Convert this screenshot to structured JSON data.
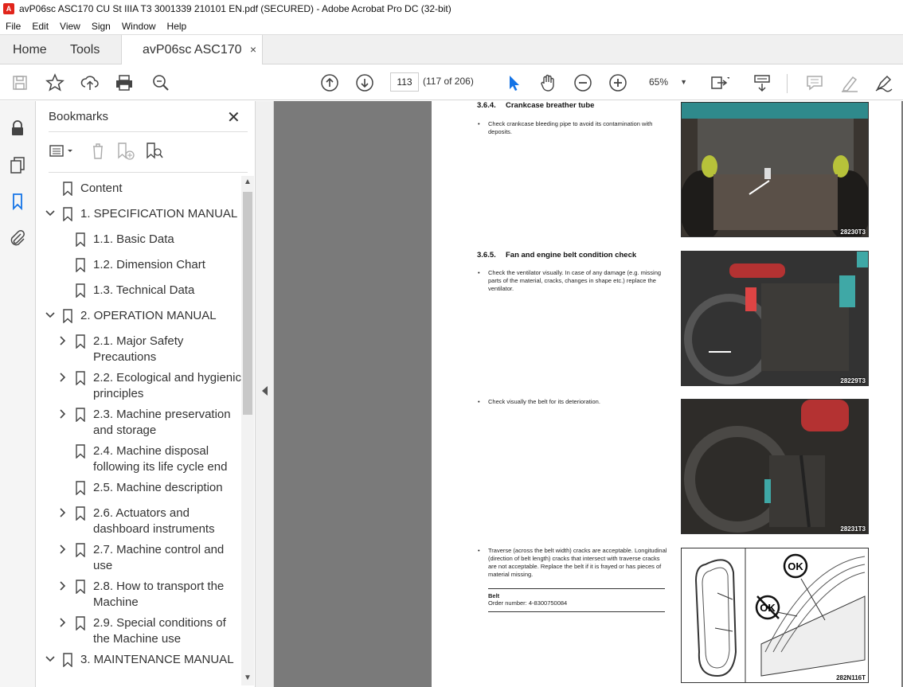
{
  "window": {
    "title": "avP06sc ASC170 CU St IIIA T3 3001339 210101 EN.pdf (SECURED) - Adobe Acrobat Pro DC (32-bit)"
  },
  "menu": [
    "File",
    "Edit",
    "View",
    "Sign",
    "Window",
    "Help"
  ],
  "tabs": {
    "home": "Home",
    "tools": "Tools",
    "document": "avP06sc ASC170 C...",
    "close": "×"
  },
  "toolbar": {
    "page_current": "113",
    "page_count": "(117 of 206)",
    "zoom": "65%",
    "icons": [
      "save-icon",
      "star-icon",
      "upload-icon",
      "print-icon",
      "search-zoom-icon",
      "page-up-icon",
      "page-down-icon",
      "select-arrow-icon",
      "hand-icon",
      "zoom-out-icon",
      "zoom-in-icon",
      "page-fit-icon",
      "scroll-mode-icon",
      "comment-icon",
      "highlight-icon",
      "sign-icon"
    ]
  },
  "leftrail": {
    "icons": [
      "lock-icon",
      "pages-icon",
      "bookmark-icon",
      "attachment-icon"
    ]
  },
  "bookmarks": {
    "title": "Bookmarks",
    "items": [
      {
        "label": "Content",
        "level": 0,
        "expander": "none"
      },
      {
        "label": "1. SPECIFICATION MANUAL",
        "level": 0,
        "expander": "expanded"
      },
      {
        "label": "1.1. Basic Data",
        "level": 1,
        "expander": "none"
      },
      {
        "label": "1.2. Dimension Chart",
        "level": 1,
        "expander": "none"
      },
      {
        "label": "1.3. Technical Data",
        "level": 1,
        "expander": "none"
      },
      {
        "label": "2. OPERATION MANUAL",
        "level": 0,
        "expander": "expanded"
      },
      {
        "label": "2.1. Major Safety",
        "label2": "Precautions",
        "level": 1,
        "expander": "collapsed"
      },
      {
        "label": "2.2. Ecological and hygienic",
        "label2": "principles",
        "level": 1,
        "expander": "collapsed"
      },
      {
        "label": "2.3. Machine preservation",
        "label2": "and storage",
        "level": 1,
        "expander": "collapsed"
      },
      {
        "label": "2.4. Machine disposal",
        "label2": "following its life cycle end",
        "level": 1,
        "expander": "none"
      },
      {
        "label": "2.5. Machine description",
        "level": 1,
        "expander": "none"
      },
      {
        "label": "2.6. Actuators and",
        "label2": "dashboard instruments",
        "level": 1,
        "expander": "collapsed"
      },
      {
        "label": "2.7. Machine control and",
        "label2": "use",
        "level": 1,
        "expander": "collapsed"
      },
      {
        "label": "2.8. How to transport the",
        "label2": "Machine",
        "level": 1,
        "expander": "collapsed"
      },
      {
        "label": "2.9. Special conditions of",
        "label2": "the Machine use",
        "level": 1,
        "expander": "collapsed"
      },
      {
        "label": "3. MAINTENANCE MANUAL",
        "level": 0,
        "expander": "expanded"
      }
    ]
  },
  "page": {
    "section1": {
      "num": "3.6.4.",
      "title": "Crankcase breather tube",
      "text": "Check crankcase bleeding pipe to avoid its contamination with deposits.",
      "photo_code": "28230T3"
    },
    "section2": {
      "num": "3.6.5.",
      "title": "Fan and engine belt condition check",
      "text": "Check the ventilator visually. In case of any damage (e.g. missing parts of the material, cracks, changes in shape etc.) replace the ventilator.",
      "photo_code": "28229T3"
    },
    "bullet3": {
      "text": "Check visually the belt for its deterioration.",
      "photo_code": "28231T3"
    },
    "bullet4": {
      "text": "Traverse (across the belt width) cracks are acceptable. Longitudinal (direction of belt length) cracks that intersect with traverse cracks are not acceptable. Replace the belt if it is frayed or has pieces of material missing.",
      "photo_code": "282N116T"
    },
    "part": {
      "title": "Belt",
      "order": "Order number: 4-8300750084"
    },
    "diagram": {
      "ok": "OK",
      "not_ok": "OK"
    }
  }
}
